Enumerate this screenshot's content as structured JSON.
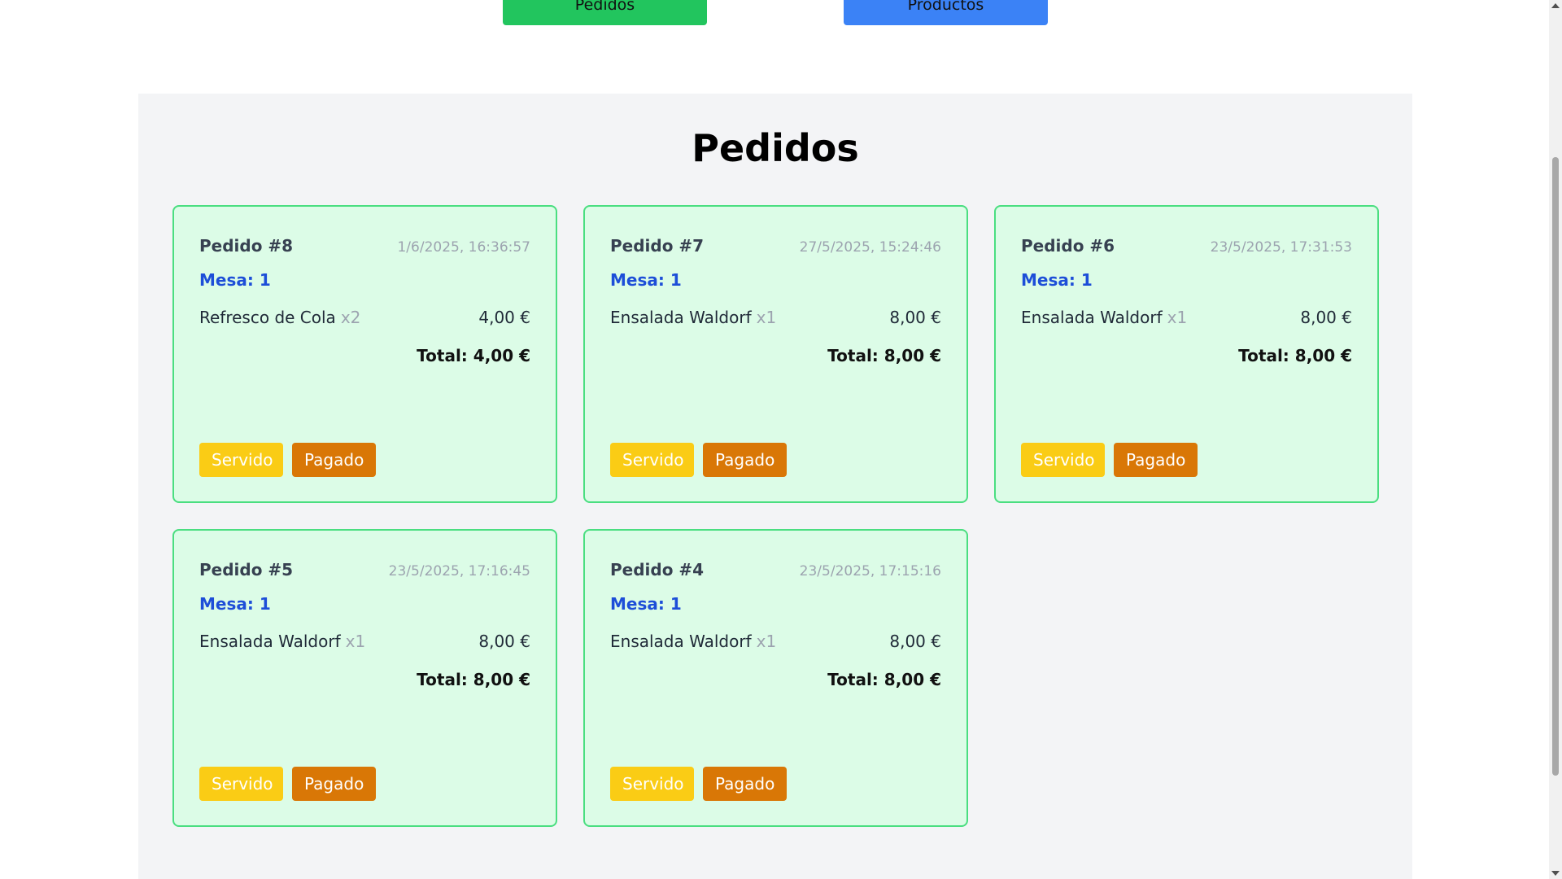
{
  "nav": {
    "pedidos_label": "Pedidos",
    "productos_label": "Productos"
  },
  "page_title": "Pedidos",
  "orders": [
    {
      "id": "Pedido #8",
      "date": "1/6/2025, 16:36:57",
      "mesa": "Mesa: 1",
      "item_name": "Refresco de Cola",
      "item_qty": "x2",
      "item_price": "4,00 €",
      "total": "Total: 4,00 €",
      "servido": "Servido",
      "pagado": "Pagado"
    },
    {
      "id": "Pedido #7",
      "date": "27/5/2025, 15:24:46",
      "mesa": "Mesa: 1",
      "item_name": "Ensalada Waldorf",
      "item_qty": "x1",
      "item_price": "8,00 €",
      "total": "Total: 8,00 €",
      "servido": "Servido",
      "pagado": "Pagado"
    },
    {
      "id": "Pedido #6",
      "date": "23/5/2025, 17:31:53",
      "mesa": "Mesa: 1",
      "item_name": "Ensalada Waldorf",
      "item_qty": "x1",
      "item_price": "8,00 €",
      "total": "Total: 8,00 €",
      "servido": "Servido",
      "pagado": "Pagado"
    },
    {
      "id": "Pedido #5",
      "date": "23/5/2025, 17:16:45",
      "mesa": "Mesa: 1",
      "item_name": "Ensalada Waldorf",
      "item_qty": "x1",
      "item_price": "8,00 €",
      "total": "Total: 8,00 €",
      "servido": "Servido",
      "pagado": "Pagado"
    },
    {
      "id": "Pedido #4",
      "date": "23/5/2025, 17:15:16",
      "mesa": "Mesa: 1",
      "item_name": "Ensalada Waldorf",
      "item_qty": "x1",
      "item_price": "8,00 €",
      "total": "Total: 8,00 €",
      "servido": "Servido",
      "pagado": "Pagado"
    }
  ],
  "colors": {
    "pedidos_nav": "#22c55e",
    "productos_nav": "#3b82f6",
    "card_bg": "#dcfce7",
    "card_border": "#4ade80",
    "mesa_text": "#1d4ed8",
    "servido_btn": "#facc15",
    "pagado_btn": "#d97706"
  }
}
